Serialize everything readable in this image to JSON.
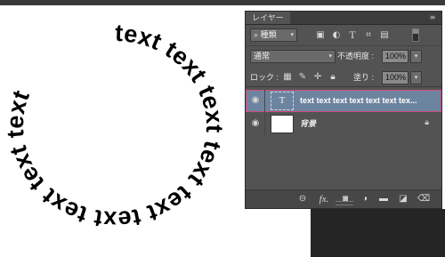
{
  "canvas": {
    "circle_text": "text text text text text text text text text"
  },
  "panel": {
    "tab_label": "レイヤー",
    "filter": {
      "label": "種類",
      "icons": [
        "image-filter-icon",
        "adjustment-filter-icon",
        "type-filter-icon",
        "shape-filter-icon",
        "smart-object-filter-icon",
        "filter-toggle"
      ]
    },
    "blend_mode": "通常",
    "opacity_label": "不透明度 :",
    "opacity_value": "100%",
    "lock_label": "ロック :",
    "fill_label": "塗り :",
    "fill_value": "100%",
    "layers": [
      {
        "name": "text text text text text text tex...",
        "kind": "text",
        "thumb_glyph": "T",
        "selected": true
      },
      {
        "name": "背景",
        "kind": "background",
        "locked": true,
        "selected": false
      }
    ],
    "footer_icons": [
      "link-layers-icon",
      "fx-icon",
      "mask-icon",
      "adjustment-layer-icon",
      "folder-icon",
      "new-layer-icon",
      "trash-icon"
    ],
    "fx_text": "fx.",
    "eye_glyph": "◉"
  },
  "colors": {
    "panel_bg": "#535353",
    "selection": "#6d84a0",
    "selection_outline": "#d14a7b"
  }
}
